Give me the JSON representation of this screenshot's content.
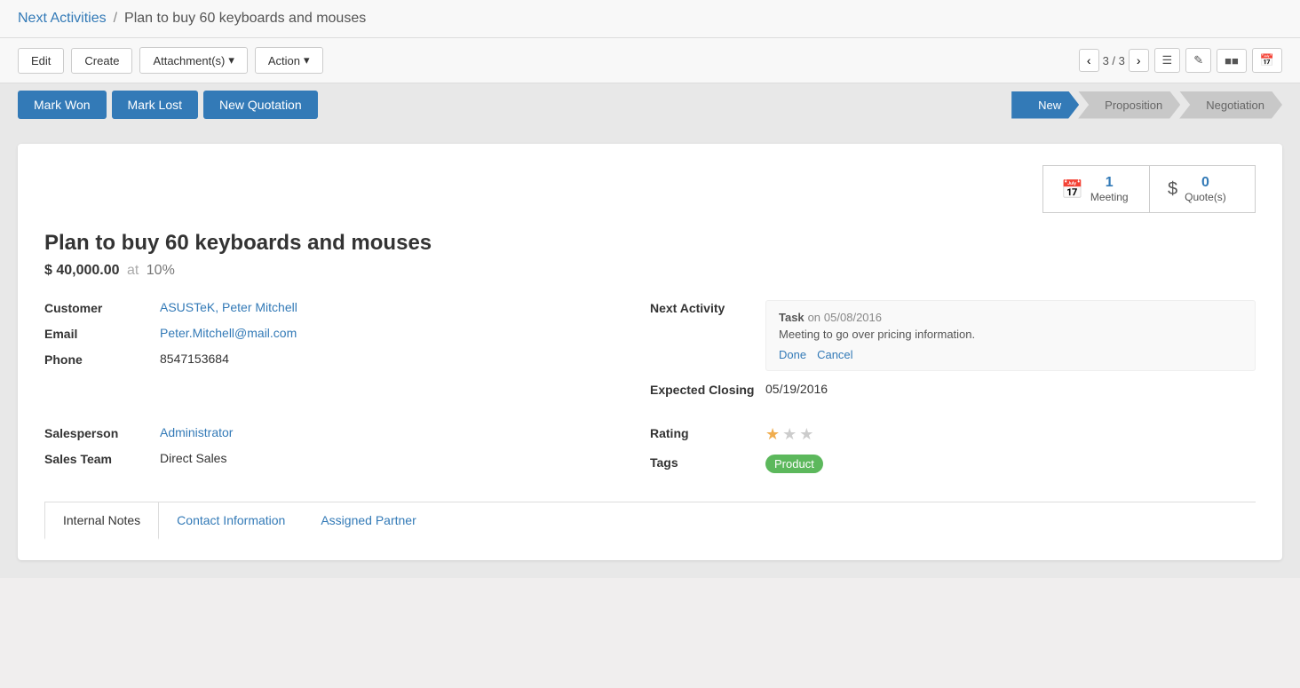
{
  "breadcrumb": {
    "link_label": "Next Activities",
    "separator": "/",
    "current": "Plan to buy 60 keyboards and mouses"
  },
  "toolbar": {
    "edit_label": "Edit",
    "create_label": "Create",
    "attachments_label": "Attachment(s)",
    "action_label": "Action",
    "page_nav": "3 / 3",
    "dropdown_arrow": "▾"
  },
  "status_bar": {
    "mark_won_label": "Mark Won",
    "mark_lost_label": "Mark Lost",
    "new_quotation_label": "New Quotation",
    "stages": [
      {
        "id": "new",
        "label": "New",
        "active": true
      },
      {
        "id": "proposition",
        "label": "Proposition",
        "active": false
      },
      {
        "id": "negotiation",
        "label": "Negotiation",
        "active": false
      }
    ]
  },
  "record": {
    "title": "Plan to buy 60 keyboards and mouses",
    "amount": "$ 40,000.00",
    "at_text": "at",
    "percent": "10%"
  },
  "smart_buttons": [
    {
      "id": "meeting",
      "count": "1",
      "label": "Meeting",
      "icon": "📅"
    },
    {
      "id": "quotes",
      "count": "0",
      "label": "Quote(s)",
      "icon": "$"
    }
  ],
  "left_fields": [
    {
      "label": "Customer",
      "value": "ASUSTeK, Peter Mitchell",
      "type": "link"
    },
    {
      "label": "Email",
      "value": "Peter.Mitchell@mail.com",
      "type": "link"
    },
    {
      "label": "Phone",
      "value": "8547153684",
      "type": "text"
    }
  ],
  "right_fields": {
    "next_activity_label": "Next Activity",
    "next_activity_task": "Task",
    "next_activity_on": "on",
    "next_activity_date": "05/08/2016",
    "next_activity_desc": "Meeting to go over pricing information.",
    "next_activity_done": "Done",
    "next_activity_cancel": "Cancel",
    "expected_closing_label": "Expected Closing",
    "expected_closing_value": "05/19/2016"
  },
  "bottom_left_fields": [
    {
      "label": "Salesperson",
      "value": "Administrator",
      "type": "link"
    },
    {
      "label": "Sales Team",
      "value": "Direct Sales",
      "type": "text"
    }
  ],
  "bottom_right_fields": {
    "rating_label": "Rating",
    "tags_label": "Tags",
    "tag_value": "Product",
    "stars": [
      true,
      false,
      false
    ]
  },
  "tabs": [
    {
      "id": "internal-notes",
      "label": "Internal Notes",
      "active": true
    },
    {
      "id": "contact-information",
      "label": "Contact Information",
      "active": false
    },
    {
      "id": "assigned-partner",
      "label": "Assigned Partner",
      "active": false
    }
  ]
}
